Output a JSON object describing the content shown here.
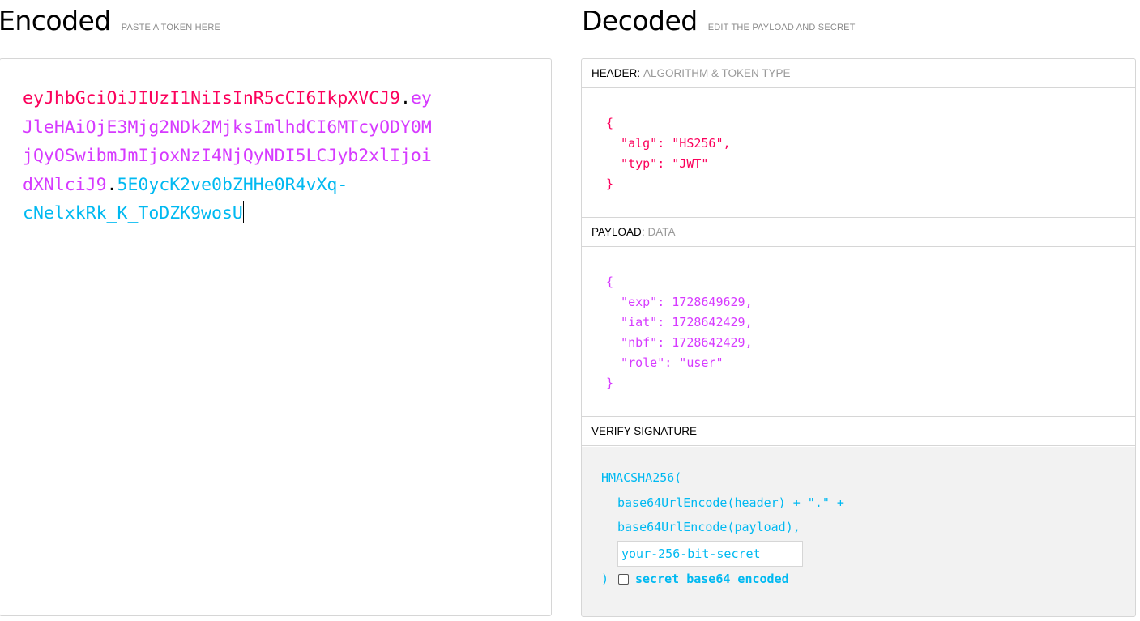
{
  "encoded": {
    "title": "Encoded",
    "hint": "PASTE A TOKEN HERE",
    "token_lines": [
      {
        "header": "eyJhbGciOiJIUzI1NiIsInR5cCI6IkpXVCJ9",
        "dot1": ".",
        "payload": "ey"
      },
      {
        "payload": "JleHAiOjE3Mjg2NDk2MjksImlhdCI6MTcyODY0M"
      },
      {
        "payload": "jQyOSwibmJmIjoxNzI4NjQyNDI5LCJyb2xlIjoi"
      },
      {
        "payload": "dXNlciJ9",
        "dot2": ".",
        "signature": "5E0ycK2ve0bZHHe0R4vXq-"
      },
      {
        "signature": "cNelxkRk_K_ToDZK9wosU"
      }
    ]
  },
  "decoded": {
    "title": "Decoded",
    "hint": "EDIT THE PAYLOAD AND SECRET",
    "header_section": {
      "label": "HEADER:",
      "sublabel": "ALGORITHM & TOKEN TYPE",
      "lines": [
        "{",
        "  \"alg\": \"HS256\",",
        "  \"typ\": \"JWT\"",
        "}"
      ]
    },
    "payload_section": {
      "label": "PAYLOAD:",
      "sublabel": "DATA",
      "lines": [
        "{",
        "  \"exp\": 1728649629,",
        "  \"iat\": 1728642429,",
        "  \"nbf\": 1728642429,",
        "  \"role\": \"user\"",
        "}"
      ]
    },
    "verify_section": {
      "label": "VERIFY SIGNATURE",
      "fn_open": "HMACSHA256(",
      "line_header": "base64UrlEncode(header) + \".\" +",
      "line_payload": "base64UrlEncode(payload),",
      "secret_placeholder": "your-256-bit-secret",
      "close": ")",
      "checkbox_label": "secret base64 encoded",
      "checkbox_checked": false
    }
  },
  "colors": {
    "header": "#fb015b",
    "payload": "#d63aff",
    "signature": "#00b9f1"
  }
}
